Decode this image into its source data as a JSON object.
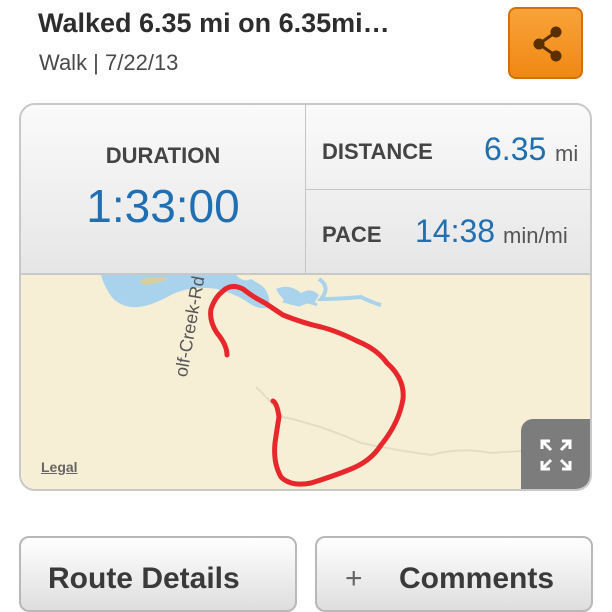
{
  "header": {
    "title": "Walked 6.35 mi on 6.35mi…",
    "subtitle": "Walk | 7/22/13",
    "share_icon": "share-icon"
  },
  "stats": {
    "duration": {
      "label": "DURATION",
      "value": "1:33:00"
    },
    "distance": {
      "label": "DISTANCE",
      "value": "6.35",
      "unit": "mi"
    },
    "pace": {
      "label": "PACE",
      "value": "14:38",
      "unit": "min/mi"
    }
  },
  "map": {
    "road_label": "olf-Creek-Rd",
    "legal_label": "Legal",
    "expand_icon": "expand-icon",
    "route_color": "#e8272d",
    "water_color": "#a9d3ec"
  },
  "buttons": {
    "route_details": "Route Details",
    "comments_plus": "+",
    "comments": "Comments"
  },
  "colors": {
    "accent_blue": "#1f6fb2",
    "share_orange": "#f08813"
  }
}
